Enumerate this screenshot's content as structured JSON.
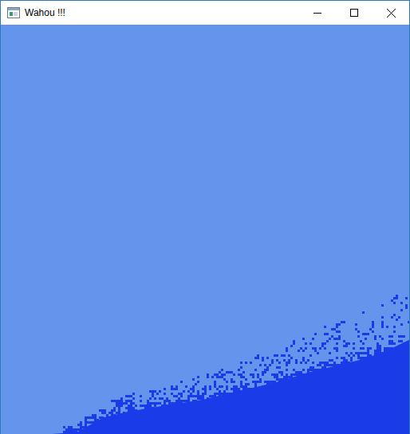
{
  "window": {
    "title": "Wahou !!!"
  },
  "sand": {
    "profile": [
      0,
      0,
      0,
      0.005,
      0.04,
      0.055,
      0.065,
      0.075,
      0.085,
      0.1,
      0.115,
      0.13,
      0.15,
      0.165,
      0.18,
      0.2,
      0.23
    ]
  }
}
